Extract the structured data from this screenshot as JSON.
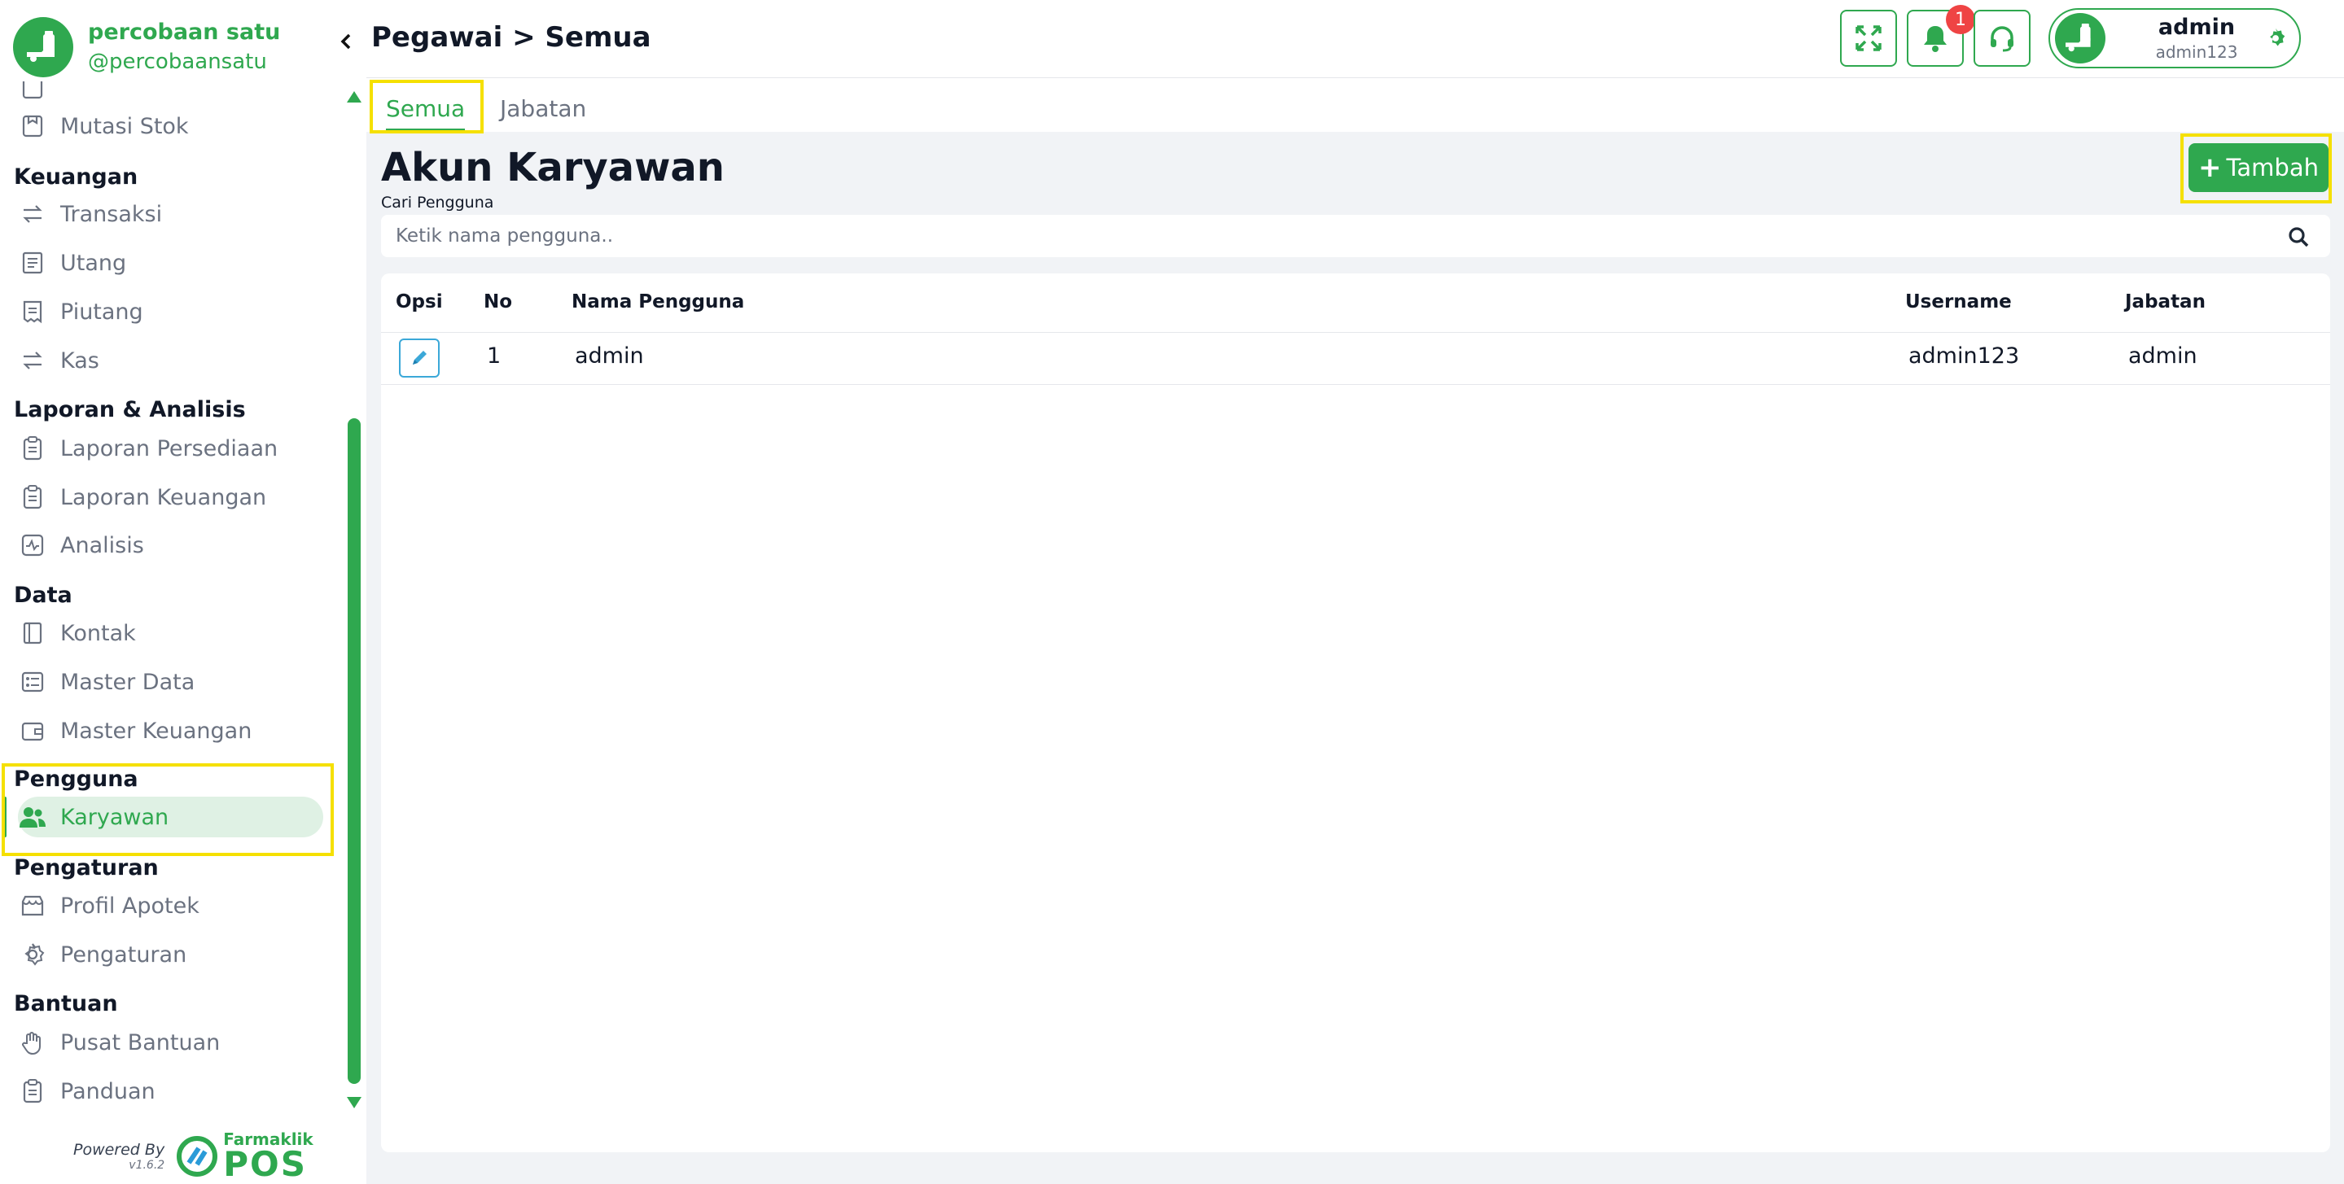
{
  "brand": {
    "name": "percobaan satu",
    "handle": "@percobaansatu"
  },
  "menu": {
    "items_top": [
      {
        "label": "Mutasi Stok"
      }
    ],
    "sections": [
      {
        "title": "Keuangan"
      },
      {
        "title": "Laporan & Analisis"
      },
      {
        "title": "Data"
      },
      {
        "title": "Pengguna"
      },
      {
        "title": "Pengaturan"
      },
      {
        "title": "Bantuan"
      }
    ],
    "keuangan": [
      "Transaksi",
      "Utang",
      "Piutang",
      "Kas"
    ],
    "laporan": [
      "Laporan Persediaan",
      "Laporan Keuangan",
      "Analisis"
    ],
    "data": [
      "Kontak",
      "Master Data",
      "Master Keuangan"
    ],
    "pengguna": [
      "Karyawan"
    ],
    "pengaturan": [
      "Profil Apotek",
      "Pengaturan"
    ],
    "bantuan": [
      "Pusat Bantuan",
      "Panduan"
    ]
  },
  "powered": {
    "by": "Powered By",
    "version": "v1.6.2",
    "brand_top": "Farmaklik",
    "brand_bottom": "POS"
  },
  "header": {
    "breadcrumb": "Pegawai > Semua",
    "notification_count": "1",
    "profile": {
      "name": "admin",
      "username": "admin123"
    }
  },
  "tabs": [
    {
      "label": "Semua"
    },
    {
      "label": "Jabatan"
    }
  ],
  "content": {
    "title": "Akun Karyawan",
    "search_label": "Cari Pengguna",
    "search_placeholder": "Ketik nama pengguna..",
    "add_label": "Tambah"
  },
  "table": {
    "columns": [
      "Opsi",
      "No",
      "Nama Pengguna",
      "Username",
      "Jabatan"
    ],
    "rows": [
      {
        "no": "1",
        "nama": "admin",
        "username": "admin123",
        "jabatan": "admin"
      }
    ]
  },
  "colors": {
    "primary": "#2fa84f",
    "highlight": "#f5e000",
    "badge": "#ef4444",
    "edit": "#3ba8d8"
  }
}
